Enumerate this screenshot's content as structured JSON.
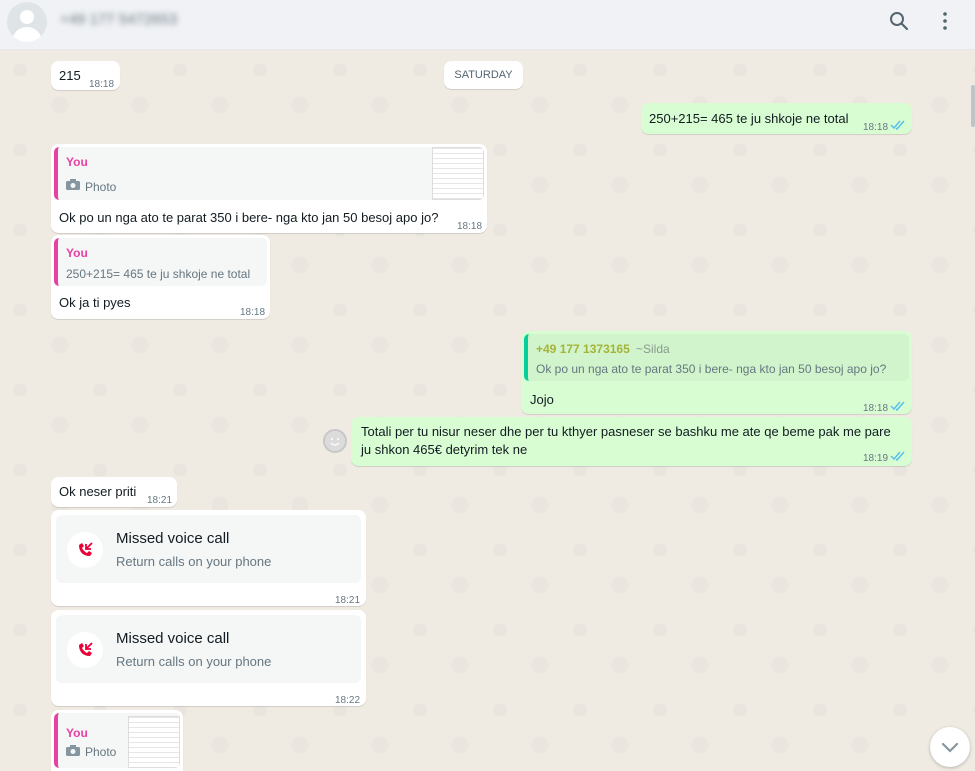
{
  "header": {
    "contact_name": "+49 177 5472653",
    "search_icon": "search-icon",
    "menu_icon": "menu-icon"
  },
  "chat": {
    "date_separator": "SATURDAY",
    "messages": [
      {
        "type": "in",
        "text": "215",
        "time": "18:18"
      },
      {
        "type": "out",
        "text": "250+215= 465 te ju shkoje ne total",
        "time": "18:18"
      },
      {
        "type": "in",
        "quote_author": "You",
        "quote_text": "Photo",
        "text": "Ok po un nga ato te parat 350 i bere- nga kto jan 50 besoj apo jo?",
        "time": "18:18"
      },
      {
        "type": "in",
        "quote_author": "You",
        "quote_text": "250+215= 465 te ju shkoje ne total",
        "text": "Ok ja ti pyes",
        "time": "18:18"
      },
      {
        "type": "out",
        "quote_author": "+49 177 1373165",
        "quote_author_name": "~Silda",
        "quote_text": "Ok po un nga ato te parat 350 i bere- nga kto jan 50 besoj apo jo?",
        "text": "Jojo",
        "time": "18:18"
      },
      {
        "type": "out",
        "text_line1": "Totali per tu nisur neser dhe per tu kthyer pasneser se bashku me ate qe beme pak me pare",
        "text_line2": "ju shkon 465€ detyrim tek ne",
        "time": "18:19"
      },
      {
        "type": "in",
        "text": "Ok neser priti",
        "time": "18:21"
      },
      {
        "type": "call",
        "title": "Missed voice call",
        "subtitle": "Return calls on your phone",
        "time": "18:21"
      },
      {
        "type": "call",
        "title": "Missed voice call",
        "subtitle": "Return calls on your phone",
        "time": "18:22"
      },
      {
        "type": "in",
        "quote_author": "You",
        "quote_text": "Photo"
      }
    ]
  },
  "colors": {
    "incoming": "#ffffff",
    "outgoing": "#d9fdd3",
    "you_accent": "#e542a3",
    "quote_green": "#06cf9c",
    "tick_blue": "#53bdeb",
    "missed_call": "#ea0038"
  }
}
